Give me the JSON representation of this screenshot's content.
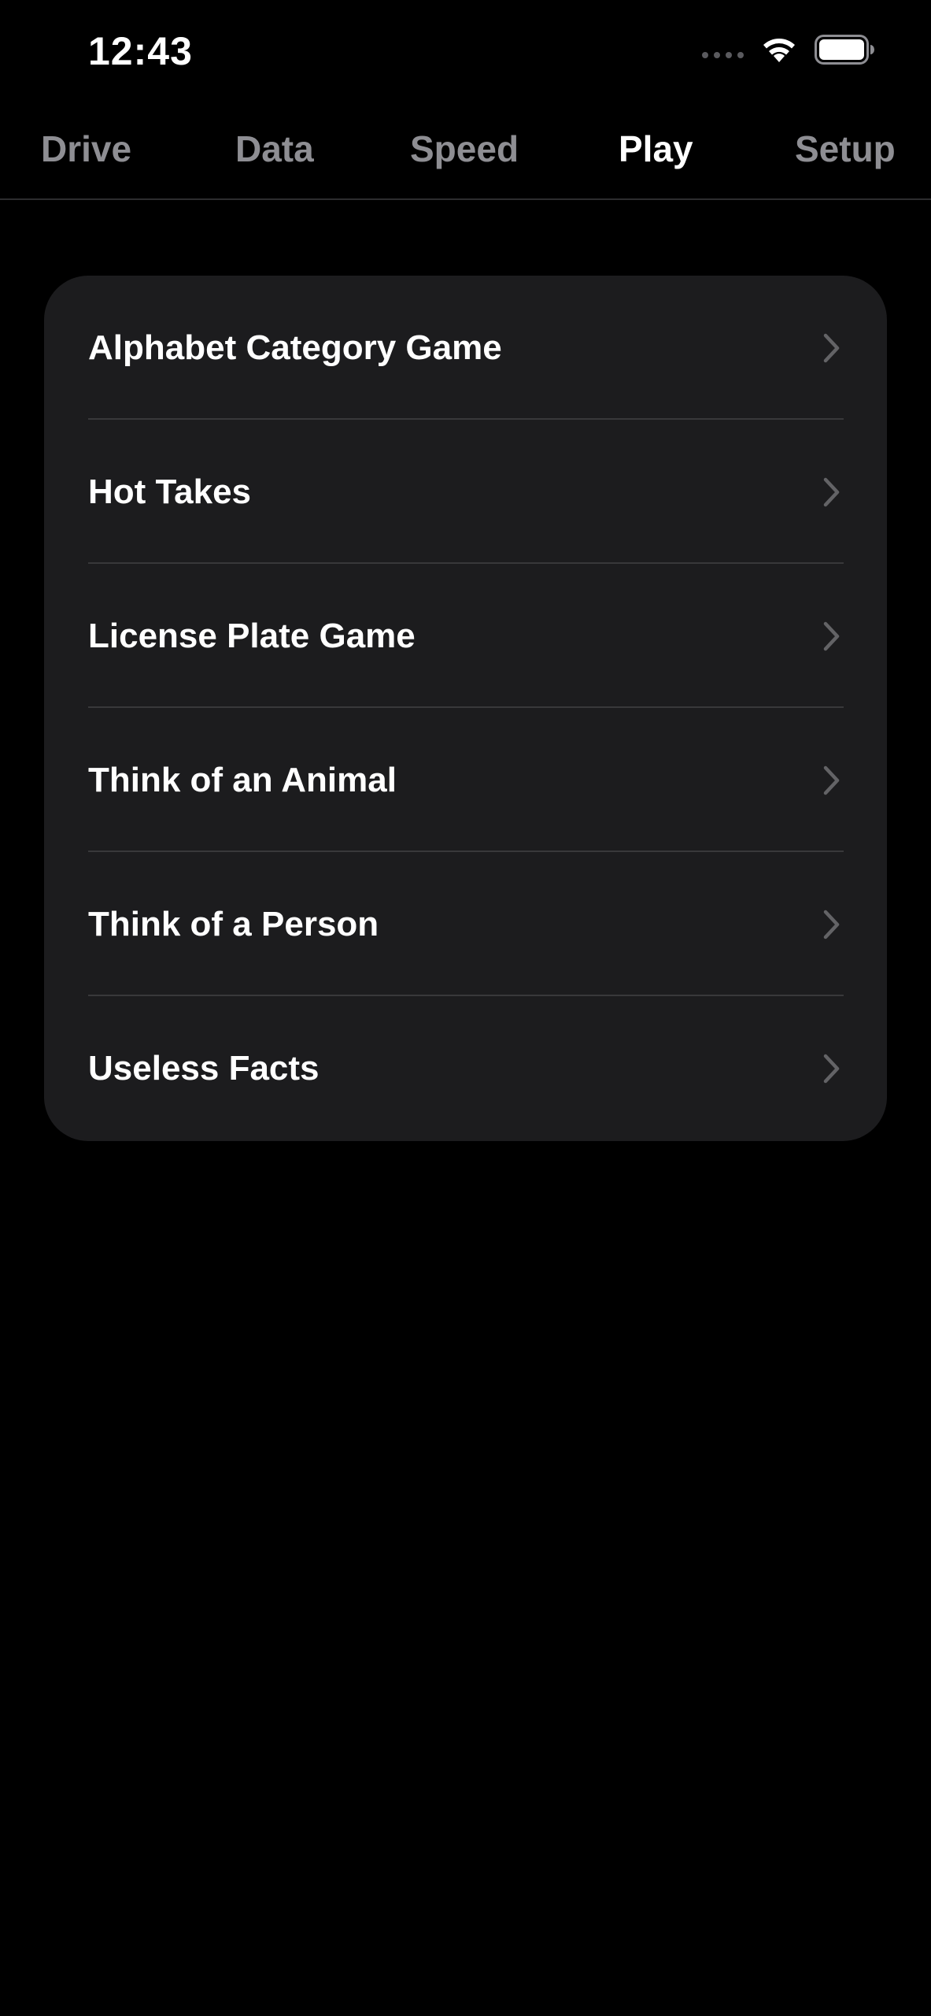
{
  "status_bar": {
    "time": "12:43"
  },
  "tabs": [
    {
      "label": "Drive",
      "active": false
    },
    {
      "label": "Data",
      "active": false
    },
    {
      "label": "Speed",
      "active": false
    },
    {
      "label": "Play",
      "active": true
    },
    {
      "label": "Setup",
      "active": false
    }
  ],
  "games": {
    "items": [
      {
        "label": "Alphabet Category Game"
      },
      {
        "label": "Hot Takes"
      },
      {
        "label": "License Plate Game"
      },
      {
        "label": "Think of an Animal"
      },
      {
        "label": "Think of a Person"
      },
      {
        "label": "Useless Facts"
      }
    ]
  },
  "colors": {
    "background": "#000000",
    "card": "#1c1c1e",
    "separator": "#38383a",
    "inactive_tab": "#8e8e93",
    "active_tab": "#ffffff",
    "chevron": "#636366"
  },
  "icons": {
    "cellular": "signal-dots-icon",
    "wifi": "wifi-icon",
    "battery": "battery-icon",
    "row_disclosure": "chevron-right-icon"
  }
}
